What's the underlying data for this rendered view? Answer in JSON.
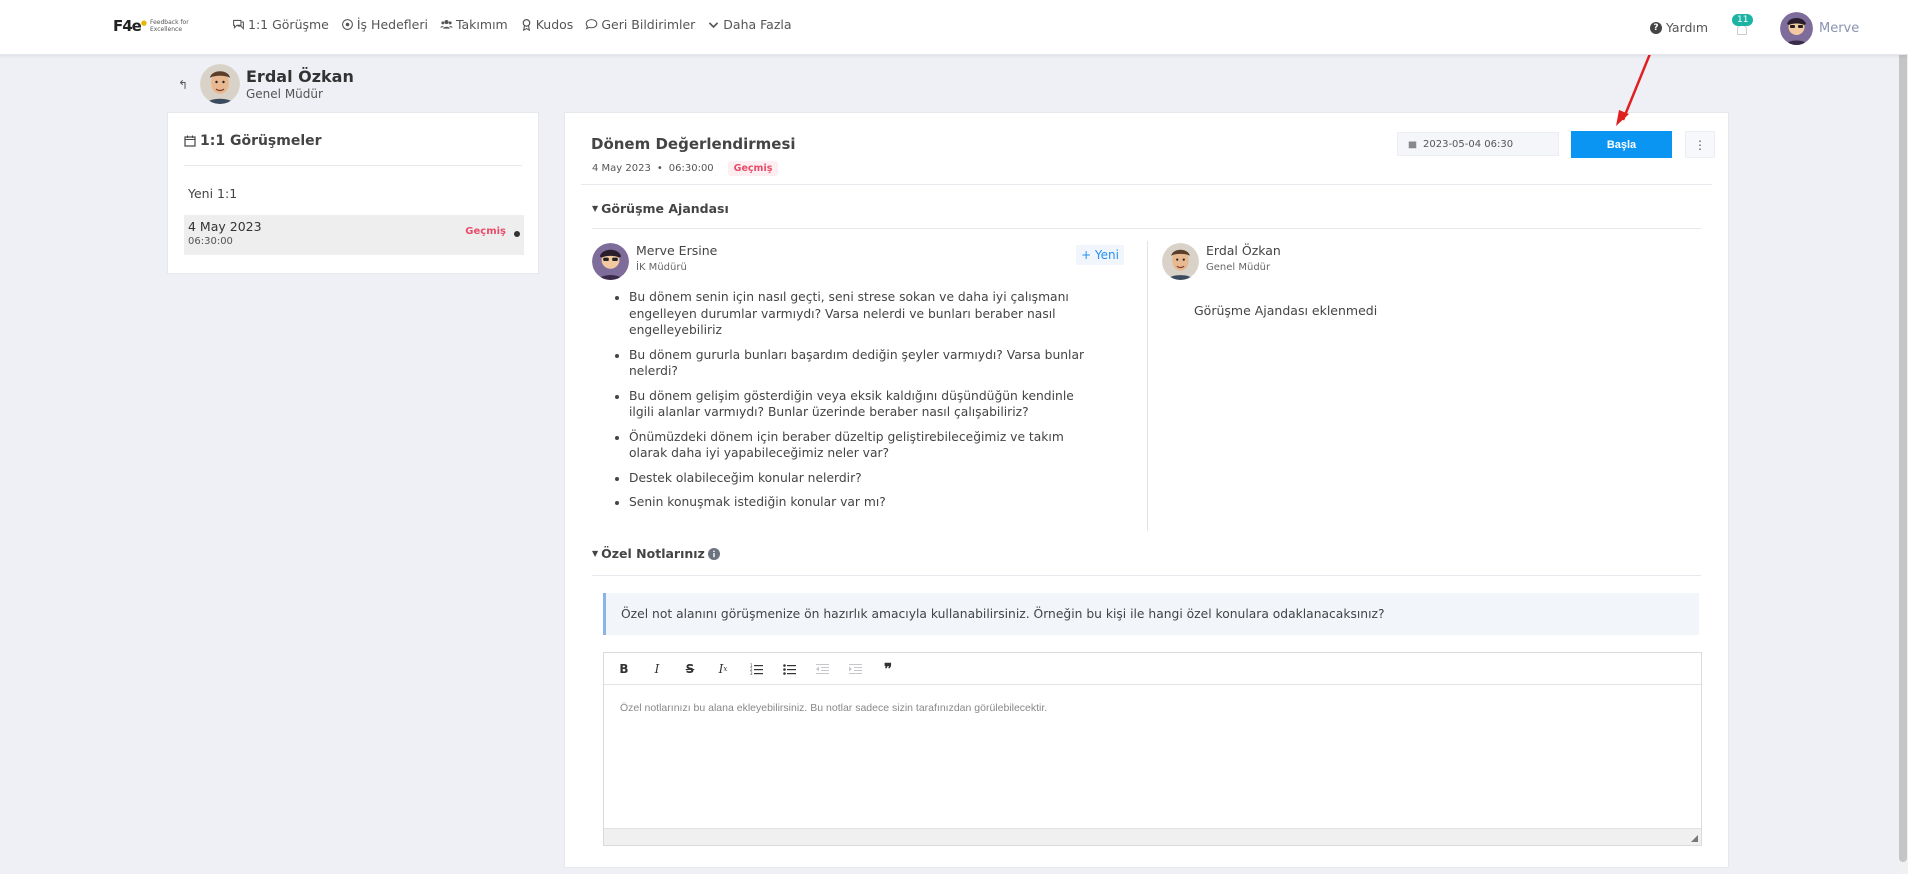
{
  "brand": {
    "logo": "F4e",
    "tagline": "Feedback for Excellence"
  },
  "nav": [
    {
      "label": "1:1 Görüşme",
      "icon": "chat-icon"
    },
    {
      "label": "İş Hedefleri",
      "icon": "target-icon"
    },
    {
      "label": "Takımım",
      "icon": "team-icon"
    },
    {
      "label": "Kudos",
      "icon": "award-icon"
    },
    {
      "label": "Geri Bildirimler",
      "icon": "comment-icon"
    },
    {
      "label": "Daha Fazla",
      "icon": "chevron-down-icon"
    }
  ],
  "header": {
    "help_label": "Yardım",
    "notification_count": "11",
    "user_name": "Merve"
  },
  "profile": {
    "name": "Erdal Özkan",
    "title": "Genel Müdür"
  },
  "sidebar": {
    "title": "1:1 Görüşmeler",
    "new_label": "Yeni 1:1",
    "meetings": [
      {
        "date": "4 May 2023",
        "time": "06:30:00",
        "status": "Geçmiş"
      }
    ]
  },
  "meeting": {
    "title": "Dönem Değerlendirmesi",
    "date": "4 May 2023",
    "time": "06:30:00",
    "status": "Geçmiş",
    "datetime_value": "2023-05-04 06:30",
    "start_label": "Başla",
    "more_label": "⋮"
  },
  "agenda": {
    "section_title": "Görüşme Ajandası",
    "left_person": {
      "name": "Merve Ersine",
      "title": "İK Müdürü"
    },
    "add_label": "+ Yeni",
    "items": [
      "Bu dönem senin için nasıl geçti, seni strese sokan ve daha iyi çalışmanı engelleyen durumlar varmıydı? Varsa nelerdi ve bunları beraber nasıl engelleyebiliriz",
      "Bu dönem gururla bunları başardım dediğin şeyler varmıydı? Varsa bunlar nelerdi?",
      "Bu dönem gelişim gösterdiğin veya eksik kaldığını düşündüğün kendinle ilgili alanlar varmıydı? Bunlar üzerinde beraber nasıl çalışabiliriz?",
      "Önümüzdeki dönem için beraber düzeltip geliştirebileceğimiz ve takım olarak daha iyi yapabileceğimiz neler var?",
      "Destek olabileceğim konular nelerdir?",
      "Senin konuşmak istediğin konular var mı?"
    ],
    "right_person": {
      "name": "Erdal Özkan",
      "title": "Genel Müdür"
    },
    "right_empty": "Görüşme Ajandası eklenmedi"
  },
  "notes": {
    "section_title": "Özel Notlarınız",
    "info_text": "Özel not alanını görüşmenize ön hazırlık amacıyla kullanabilirsiniz. Örneğin bu kişi ile hangi özel konulara odaklanacaksınız?",
    "placeholder": "Özel notlarınızı bu alana ekleyebilirsiniz. Bu notlar sadece sizin tarafınızdan görülebilecektir."
  },
  "colors": {
    "primary": "#0b95f2",
    "badge_past": "#e84c6a",
    "notification": "#1cb3a4",
    "annotation": "#e02020"
  }
}
